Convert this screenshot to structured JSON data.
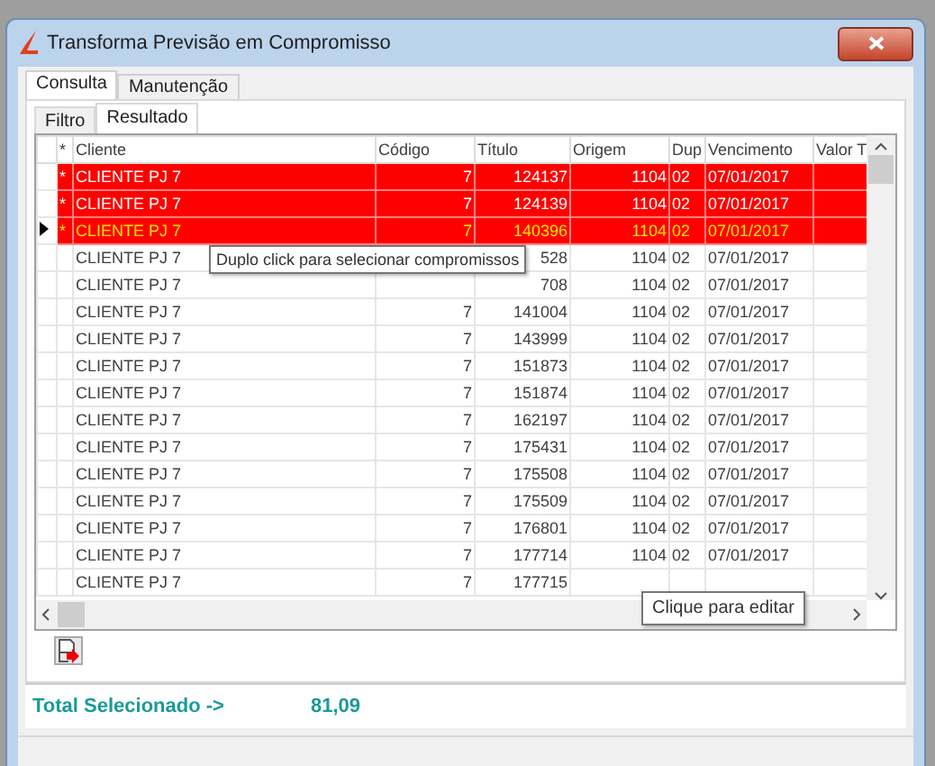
{
  "window": {
    "title": "Transforma Previsão em Compromisso"
  },
  "tabs": [
    {
      "label": "Consulta",
      "selected": true
    },
    {
      "label": "Manutenção",
      "selected": false
    }
  ],
  "subtabs": [
    {
      "label": "Filtro",
      "selected": false
    },
    {
      "label": "Resultado",
      "selected": true
    }
  ],
  "table": {
    "columns": [
      "*",
      "Cliente",
      "Código",
      "Título",
      "Origem",
      "Dup",
      "Vencimento",
      "Valor T"
    ],
    "rows": [
      {
        "star": "*",
        "cliente": "CLIENTE PJ 7",
        "codigo": "7",
        "titulo": "124137",
        "origem": "1104",
        "dup": "02",
        "vencimento": "07/01/2017",
        "selected": true,
        "current": false
      },
      {
        "star": "*",
        "cliente": "CLIENTE PJ 7",
        "codigo": "7",
        "titulo": "124139",
        "origem": "1104",
        "dup": "02",
        "vencimento": "07/01/2017",
        "selected": true,
        "current": false
      },
      {
        "star": "*",
        "cliente": "CLIENTE PJ 7",
        "codigo": "7",
        "titulo": "140396",
        "origem": "1104",
        "dup": "02",
        "vencimento": "07/01/2017",
        "selected": true,
        "current": true
      },
      {
        "cliente": "CLIENTE PJ 7",
        "titulo": "528",
        "origem": "1104",
        "dup": "02",
        "vencimento": "07/01/2017",
        "selected": false,
        "current": false
      },
      {
        "cliente": "CLIENTE PJ 7",
        "titulo": "708",
        "origem": "1104",
        "dup": "02",
        "vencimento": "07/01/2017",
        "selected": false,
        "current": false
      },
      {
        "cliente": "CLIENTE PJ 7",
        "codigo": "7",
        "titulo": "141004",
        "origem": "1104",
        "dup": "02",
        "vencimento": "07/01/2017",
        "selected": false,
        "current": false
      },
      {
        "cliente": "CLIENTE PJ 7",
        "codigo": "7",
        "titulo": "143999",
        "origem": "1104",
        "dup": "02",
        "vencimento": "07/01/2017",
        "selected": false,
        "current": false
      },
      {
        "cliente": "CLIENTE PJ 7",
        "codigo": "7",
        "titulo": "151873",
        "origem": "1104",
        "dup": "02",
        "vencimento": "07/01/2017",
        "selected": false,
        "current": false
      },
      {
        "cliente": "CLIENTE PJ 7",
        "codigo": "7",
        "titulo": "151874",
        "origem": "1104",
        "dup": "02",
        "vencimento": "07/01/2017",
        "selected": false,
        "current": false
      },
      {
        "cliente": "CLIENTE PJ 7",
        "codigo": "7",
        "titulo": "162197",
        "origem": "1104",
        "dup": "02",
        "vencimento": "07/01/2017",
        "selected": false,
        "current": false
      },
      {
        "cliente": "CLIENTE PJ 7",
        "codigo": "7",
        "titulo": "175431",
        "origem": "1104",
        "dup": "02",
        "vencimento": "07/01/2017",
        "selected": false,
        "current": false
      },
      {
        "cliente": "CLIENTE PJ 7",
        "codigo": "7",
        "titulo": "175508",
        "origem": "1104",
        "dup": "02",
        "vencimento": "07/01/2017",
        "selected": false,
        "current": false
      },
      {
        "cliente": "CLIENTE PJ 7",
        "codigo": "7",
        "titulo": "175509",
        "origem": "1104",
        "dup": "02",
        "vencimento": "07/01/2017",
        "selected": false,
        "current": false
      },
      {
        "cliente": "CLIENTE PJ 7",
        "codigo": "7",
        "titulo": "176801",
        "origem": "1104",
        "dup": "02",
        "vencimento": "07/01/2017",
        "selected": false,
        "current": false
      },
      {
        "cliente": "CLIENTE PJ 7",
        "codigo": "7",
        "titulo": "177714",
        "origem": "1104",
        "dup": "02",
        "vencimento": "07/01/2017",
        "selected": false,
        "current": false
      },
      {
        "cliente": "CLIENTE PJ 7",
        "codigo": "7",
        "titulo": "177715",
        "selected": false,
        "current": false
      }
    ]
  },
  "tooltips": [
    {
      "text": "Duplo click para selecionar compromissos"
    },
    {
      "text": "Clique para editar"
    }
  ],
  "total": {
    "label": "Total Selecionado ->",
    "value": "81,09"
  }
}
